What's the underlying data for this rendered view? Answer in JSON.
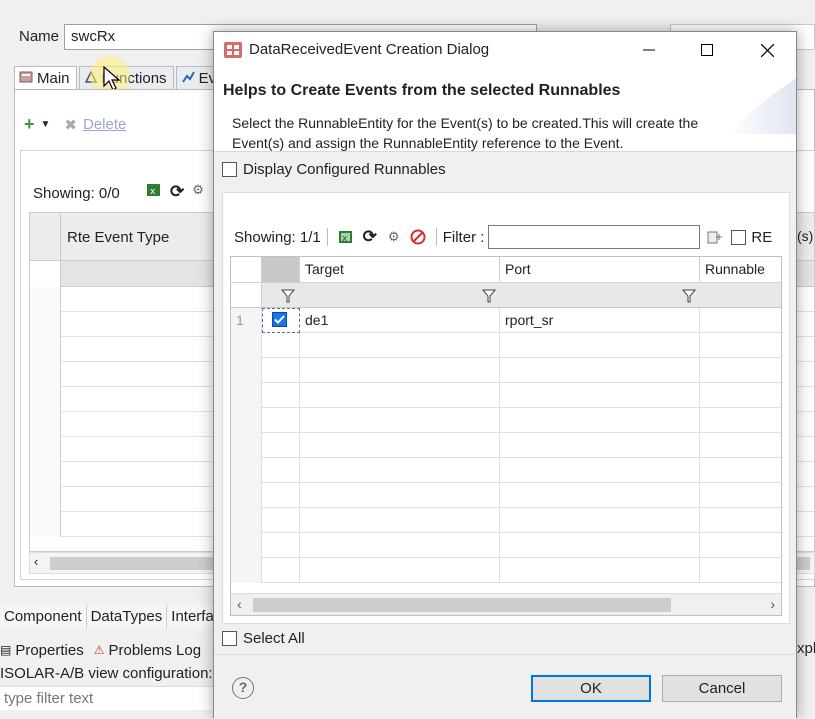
{
  "background": {
    "name_label": "Name",
    "name_value": "swcRx",
    "tabs": [
      {
        "label": "Main"
      },
      {
        "label": "Functions"
      },
      {
        "label": "Eve"
      }
    ],
    "toolbar": {
      "delete_label": "Delete"
    },
    "showing": "Showing: 0/0",
    "table_header": "Rte Event Type",
    "bottom_tabs": [
      "Component",
      "DataTypes",
      "Interfac"
    ],
    "view_tabs": [
      "Properties",
      "Problems Log"
    ],
    "view_config": "ISOLAR-A/B view configuration:",
    "filter_placeholder": "type filter text",
    "right_stub_top": "(s)",
    "right_stub_bottom": "xpl"
  },
  "dialog": {
    "title": "DataReceivedEvent Creation Dialog",
    "header_title": "Helps to Create Events from the selected Runnables",
    "header_desc": "Select the RunnableEntity for the Event(s) to be created.This will create the Event(s) and assign the RunnableEntity reference to the Event.",
    "display_configured_label": "Display Configured Runnables",
    "display_configured_checked": false,
    "showing": "Showing: 1/1",
    "filter_label": "Filter :",
    "filter_value": "",
    "re_label": "RE",
    "columns": [
      "Target",
      "Port",
      "Runnable"
    ],
    "rows": [
      {
        "num": "1",
        "checked": true,
        "target": "de1",
        "port": "rport_sr",
        "runnable": ""
      }
    ],
    "select_all_label": "Select All",
    "ok_label": "OK",
    "cancel_label": "Cancel",
    "colors": {
      "accent": "#0078d7",
      "checked": "#1a73e8"
    }
  }
}
